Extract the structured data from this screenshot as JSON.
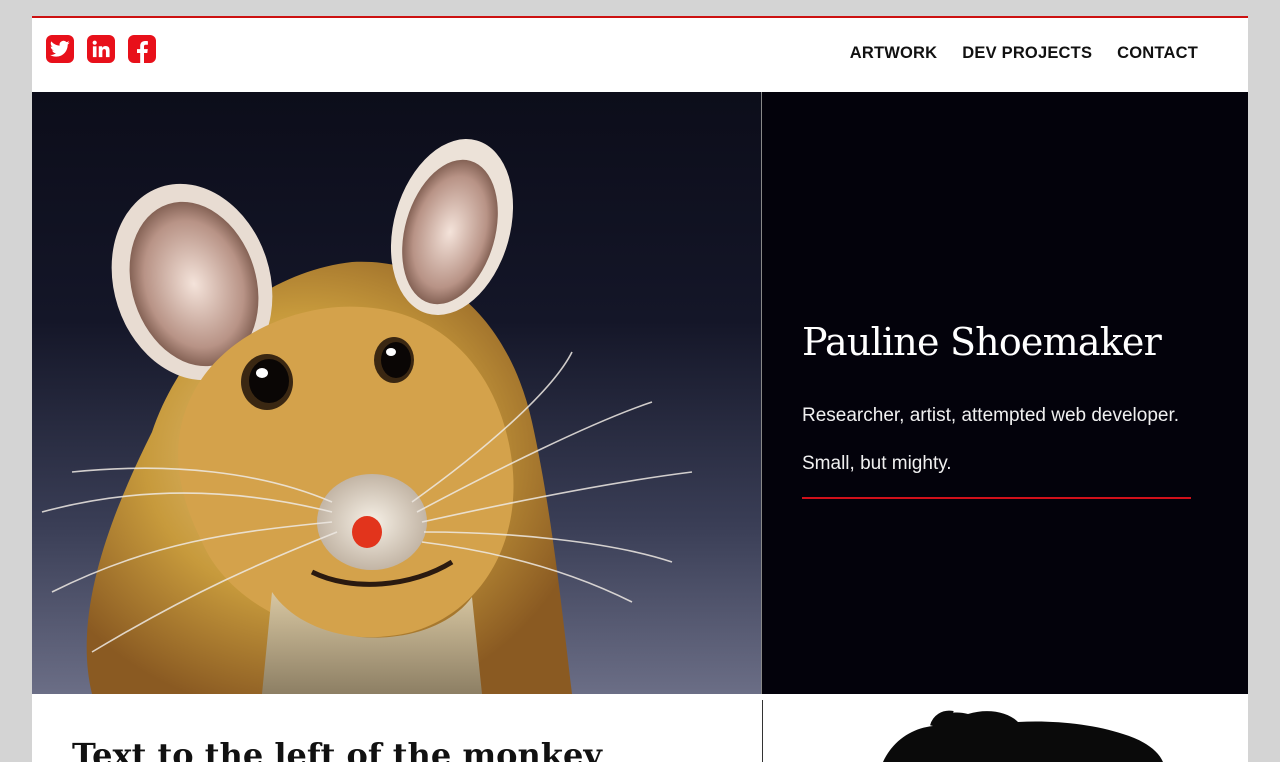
{
  "social": [
    {
      "name": "twitter-icon"
    },
    {
      "name": "linkedin-icon"
    },
    {
      "name": "facebook-icon"
    }
  ],
  "nav": {
    "items": [
      "ARTWORK",
      "DEV PROJECTS",
      "CONTACT"
    ]
  },
  "hero": {
    "title": "Pauline Shoemaker",
    "tagline": "Researcher, artist, attempted web developer.",
    "motto": "Small, but mighty.",
    "image": "painting of a mouse"
  },
  "section": {
    "title": "Text to the left of the monkey"
  },
  "colors": {
    "accent": "#d0101a",
    "panel": "#03020b",
    "page_bg": "#d4d4d4"
  }
}
